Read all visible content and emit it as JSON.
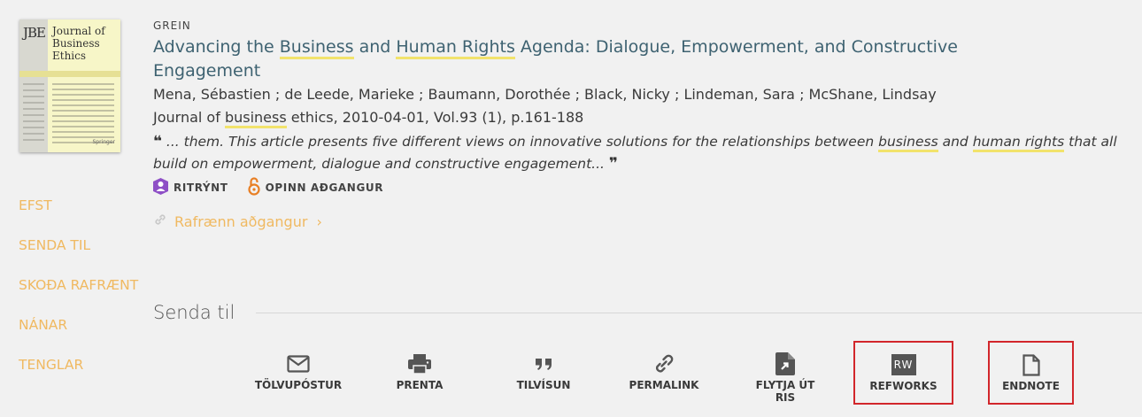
{
  "result": {
    "type": "GREIN",
    "title_parts": [
      {
        "text": "Advancing the ",
        "hl": false
      },
      {
        "text": "Business",
        "hl": true
      },
      {
        "text": " and ",
        "hl": false
      },
      {
        "text": "Human Rights",
        "hl": true
      },
      {
        "text": " Agenda: Dialogue, Empowerment, and Constructive Engagement",
        "hl": false
      }
    ],
    "authors": "Mena, Sébastien ; de Leede, Marieke ; Baumann, Dorothée ; Black, Nicky ; Lindeman, Sara ; McShane, Lindsay",
    "source_parts": [
      {
        "text": "Journal of ",
        "hl": false
      },
      {
        "text": "business",
        "hl": true
      },
      {
        "text": " ethics, 2010-04-01, Vol.93 (1), p.161-188",
        "hl": false
      }
    ],
    "snippet_parts": [
      {
        "text": " ... them. This article presents five different views on innovative solutions for the relationships between ",
        "hl": false
      },
      {
        "text": "business",
        "hl": true
      },
      {
        "text": " and ",
        "hl": false
      },
      {
        "text": "human rights",
        "hl": true
      },
      {
        "text": " that all build on empowerment, dialogue and constructive engagement... ",
        "hl": false
      }
    ],
    "quote_open": "❝",
    "quote_close": "❞",
    "badges": {
      "peer_reviewed": "RITRÝNT",
      "open_access": "OPINN AÐGANGUR"
    },
    "online_access": "Rafrænn aðgangur",
    "online_chevron": "›"
  },
  "cover": {
    "abbr": "JBE",
    "title": "Journal of Business Ethics",
    "publisher": "Springer"
  },
  "sidenav": [
    "EFST",
    "SENDA TIL",
    "SKOÐA RAFRÆNT",
    "NÁNAR",
    "TENGLAR"
  ],
  "send_to": {
    "heading": "Senda til",
    "actions": [
      {
        "label": "TÖLVUPÓSTUR",
        "icon": "email-icon"
      },
      {
        "label": "PRENTA",
        "icon": "print-icon"
      },
      {
        "label": "TILVÍSUN",
        "icon": "citation-quote-icon"
      },
      {
        "label": "PERMALINK",
        "icon": "link-icon"
      },
      {
        "label": "FLYTJA ÚT RIS",
        "icon": "export-ris-icon"
      },
      {
        "label": "REFWORKS",
        "icon": "refworks-icon",
        "icon_text": "RW"
      },
      {
        "label": "ENDNOTE",
        "icon": "document-icon"
      }
    ]
  },
  "colors": {
    "title": "#3e6271",
    "highlight": "#f2e36c",
    "accent_link": "#f0b961",
    "peer_review_icon": "#8e4fc6",
    "open_access_icon": "#e87f24",
    "annotation_box": "#d2262b"
  }
}
